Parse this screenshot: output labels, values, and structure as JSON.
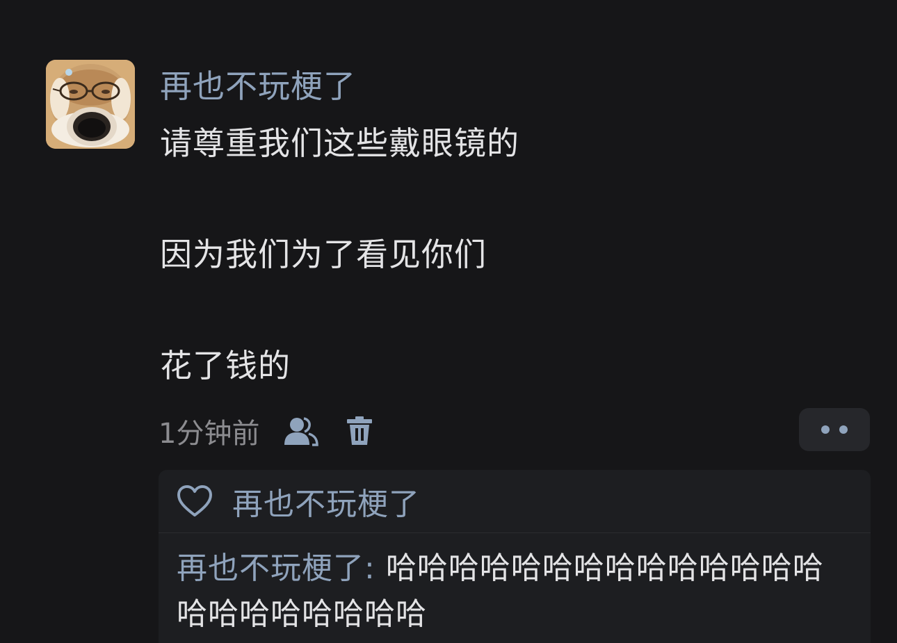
{
  "comment": {
    "username": "再也不玩梗了",
    "avatar_icon": "doge-with-glasses-avatar",
    "lines": [
      "请尊重我们这些戴眼镜的",
      "因为我们为了看见你们",
      "花了钱的"
    ],
    "time": "1分钟前",
    "actions": {
      "user_icon": "user-icon",
      "delete_icon": "trash-icon",
      "more_icon": "more-dots-icon"
    }
  },
  "likes": {
    "icon": "heart-icon",
    "names": "再也不玩梗了"
  },
  "replies": [
    {
      "author": "再也不玩梗了",
      "separator": ": ",
      "text": "哈哈哈哈哈哈哈哈哈哈哈哈哈哈哈哈哈哈哈哈哈哈"
    }
  ],
  "colors": {
    "background": "#161618",
    "name_accent": "#8fa3bc",
    "text": "#e4e4e6",
    "muted": "#8c8c90",
    "panel": "#1d1e21"
  }
}
